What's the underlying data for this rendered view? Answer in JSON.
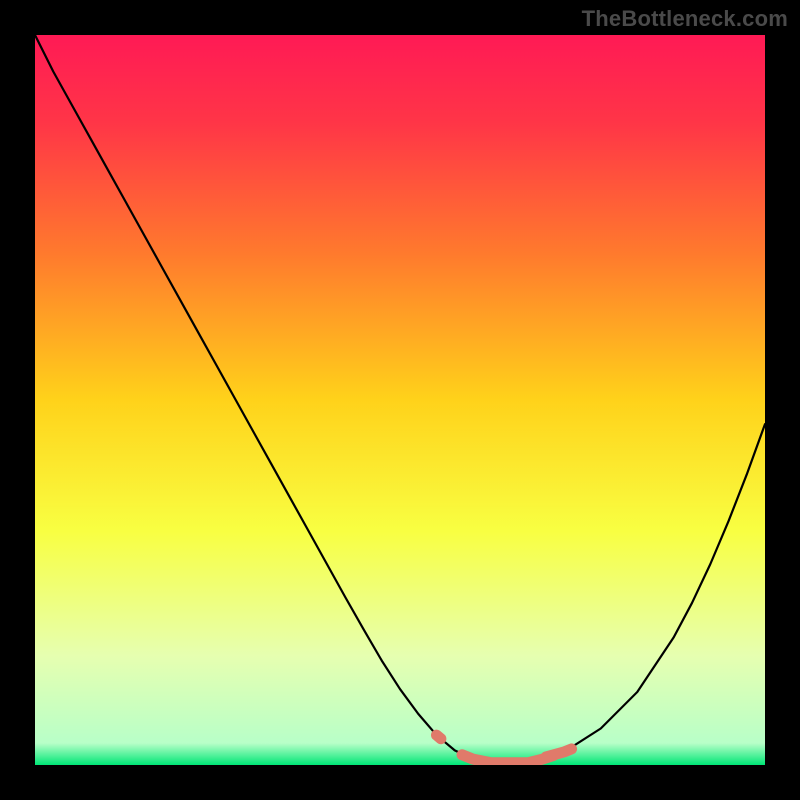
{
  "watermark": "TheBottleneck.com",
  "chart_data": {
    "type": "line",
    "title": "",
    "xlabel": "",
    "ylabel": "",
    "xlim": [
      0,
      100
    ],
    "ylim": [
      0,
      100
    ],
    "grid": false,
    "background_gradient": {
      "stops": [
        {
          "offset": 0.0,
          "color": "#ff1a55"
        },
        {
          "offset": 0.12,
          "color": "#ff3547"
        },
        {
          "offset": 0.3,
          "color": "#ff7a2d"
        },
        {
          "offset": 0.5,
          "color": "#ffd21a"
        },
        {
          "offset": 0.68,
          "color": "#f8ff42"
        },
        {
          "offset": 0.85,
          "color": "#e6ffb0"
        },
        {
          "offset": 0.97,
          "color": "#b8ffc8"
        },
        {
          "offset": 1.0,
          "color": "#00e676"
        }
      ]
    },
    "series": [
      {
        "name": "bottleneck-curve",
        "color": "#000000",
        "x": [
          0,
          2.5,
          5,
          7.5,
          10,
          12.5,
          15,
          17.5,
          20,
          22.5,
          25,
          27.5,
          30,
          32.5,
          35,
          37.5,
          40,
          42.5,
          45,
          47.5,
          50,
          52.5,
          55,
          57.5,
          60,
          62.5,
          65,
          67.5,
          72.5,
          77.5,
          82.5,
          87.5,
          90,
          92.5,
          95,
          97.5,
          100
        ],
        "y": [
          100,
          95,
          90.5,
          86,
          81.5,
          77,
          72.5,
          68,
          63.5,
          59,
          54.5,
          50,
          45.5,
          41,
          36.5,
          32,
          27.5,
          23,
          18.6,
          14.3,
          10.4,
          7.0,
          4.1,
          2.0,
          0.8,
          0.3,
          0.3,
          0.3,
          1.8,
          5.0,
          10.0,
          17.5,
          22.2,
          27.5,
          33.4,
          39.8,
          46.7
        ]
      }
    ],
    "annotations": {
      "highlight_segments": [
        {
          "name": "highlight-left-dot",
          "color": "#e07a6a",
          "x": [
            55,
            55.6
          ],
          "y": [
            4.1,
            3.6
          ]
        },
        {
          "name": "highlight-valley",
          "color": "#e07a6a",
          "x": [
            58.5,
            60,
            62.5,
            65,
            67.5,
            69.5,
            71.0
          ],
          "y": [
            1.4,
            0.8,
            0.3,
            0.3,
            0.3,
            0.8,
            1.3
          ]
        },
        {
          "name": "highlight-right-tick",
          "color": "#e07a6a",
          "x": [
            70.0,
            72.5,
            73.5
          ],
          "y": [
            1.1,
            1.8,
            2.2
          ]
        }
      ]
    }
  }
}
